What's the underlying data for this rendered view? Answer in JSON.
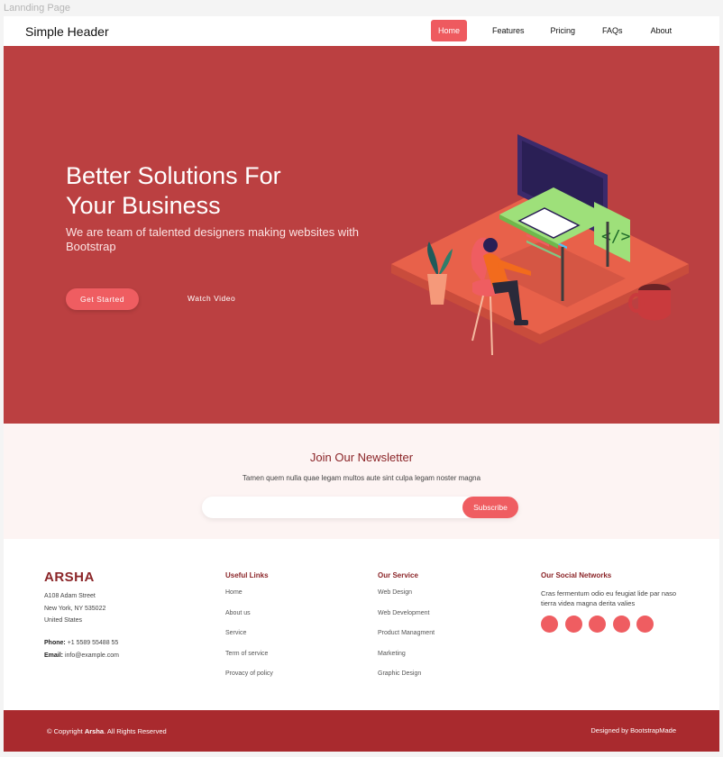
{
  "frame_label": "Lannding Page",
  "header": {
    "brand": "Simple Header",
    "nav": [
      "Home",
      "Features",
      "Pricing",
      "FAQs",
      "About"
    ]
  },
  "hero": {
    "title": "Better Solutions For Your Business",
    "subtitle": "We are team of talented designers making websites with Bootstrap",
    "primary_button": "Get Started",
    "secondary_button": "Watch Video"
  },
  "newsletter": {
    "title": "Join Our Newsletter",
    "description": "Tamen quem nulla quae legam multos aute sint culpa legam noster magna",
    "input_value": "",
    "button": "Subscribe"
  },
  "footer": {
    "logo": "ARSHA",
    "address": [
      "A108 Adam Street",
      "New York, NY 535022",
      "United States"
    ],
    "phone_label": "Phone:",
    "phone": "+1 5589 55488 55",
    "email_label": "Email:",
    "email": "info@example.com",
    "useful_links": {
      "title": "Useful Links",
      "items": [
        "Home",
        "About us",
        "Service",
        "Term of service",
        "Provacy of policy"
      ]
    },
    "services": {
      "title": "Our Service",
      "items": [
        "Web Design",
        "Web Development",
        "Product Managment",
        "Marketing",
        "Graphic Design"
      ]
    },
    "social": {
      "title": "Our Social Networks",
      "text": "Cras fermentum odio eu feugiat lide par naso tierra videa magna derita valies",
      "icons": [
        "twitter-icon",
        "facebook-icon",
        "instagram-icon",
        "skype-icon",
        "linkedin-icon"
      ]
    }
  },
  "copyright": {
    "prefix": "© Copyright",
    "brand": "Arsha",
    "suffix": ". All Rights Reserved",
    "credit": "Designed by BootstrapMade"
  },
  "colors": {
    "accent": "#ef5d61",
    "hero_bg": "#bb4041",
    "brand_dark": "#8b2528",
    "footer_bar": "#a92a2e"
  }
}
